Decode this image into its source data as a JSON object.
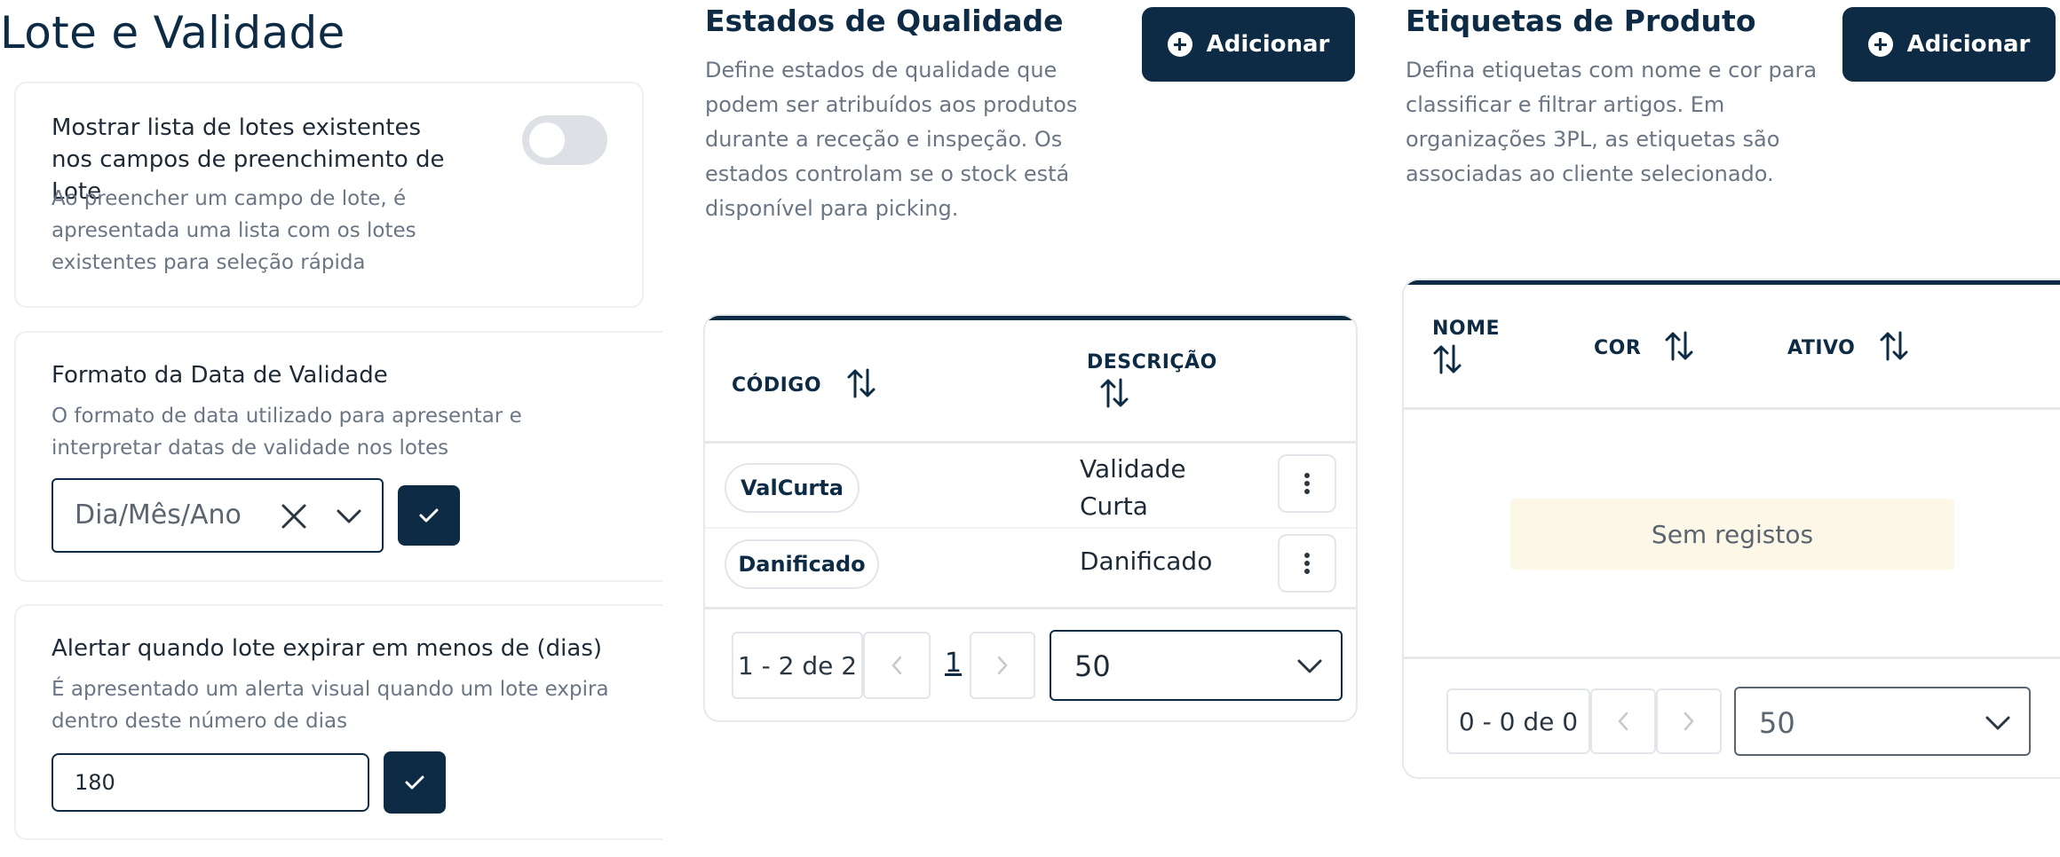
{
  "lote": {
    "title": "Lote e Validade",
    "show_list": {
      "title": "Mostrar lista de lotes existentes nos campos de preenchimento de Lote",
      "description": "Ao preencher um campo de lote, é apresentada uma lista com os lotes existentes para seleção rápida",
      "enabled": false
    },
    "date_format": {
      "title": "Formato da Data de Validade",
      "description": "O formato de data utilizado para apresentar e interpretar datas de validade nos lotes",
      "selected": "Dia/Mês/Ano"
    },
    "expiry_alert": {
      "title": "Alertar quando lote expirar em menos de (dias)",
      "description": "É apresentado um alerta visual quando um lote expira dentro deste número de dias",
      "value": "180"
    }
  },
  "quality": {
    "title": "Estados de Qualidade",
    "add_label": "Adicionar",
    "description": "Define estados de qualidade que podem ser atribuídos aos produtos durante a receção e inspeção. Os estados controlam se o stock está disponível para picking.",
    "columns": [
      "CÓDIGO",
      "DESCRIÇÃO"
    ],
    "rows": [
      {
        "code": "ValCurta",
        "description": "Validade Curta"
      },
      {
        "code": "Danificado",
        "description": "Danificado"
      }
    ],
    "pager": {
      "range": "1 - 2 de 2",
      "page": "1",
      "rows_per_page": "50"
    }
  },
  "tags": {
    "title": "Etiquetas de Produto",
    "add_label": "Adicionar",
    "description": "Defina etiquetas com nome e cor para classificar e filtrar artigos. Em organizações 3PL, as etiquetas são associadas ao cliente selecionado.",
    "columns": [
      "NOME",
      "COR",
      "ATIVO"
    ],
    "empty": "Sem registos",
    "pager": {
      "range": "0 - 0 de 0",
      "rows_per_page": "50"
    }
  },
  "colors": {
    "primary": "#0d2b45",
    "muted": "#6b7684",
    "empty_bg": "#fdf7e7"
  }
}
